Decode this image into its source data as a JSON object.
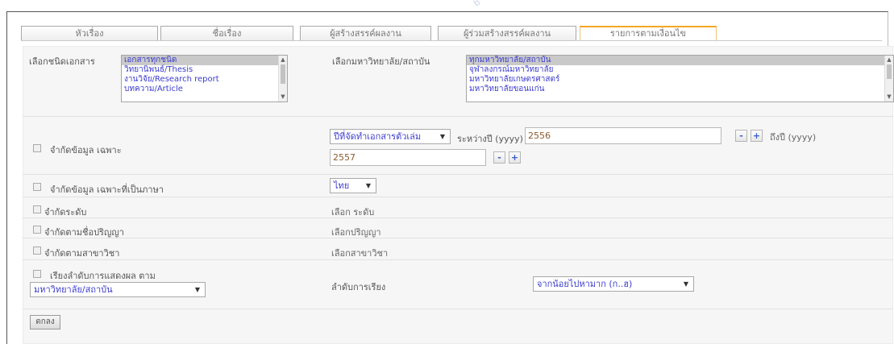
{
  "tabs": [
    {
      "label": "หัวเรื่อง",
      "active": false
    },
    {
      "label": "ชื่อเรื่อง",
      "active": false
    },
    {
      "label": "ผู้สร้างสรรค์ผลงาน",
      "active": false
    },
    {
      "label": "ผู้ร่วมสร้างสรรค์ผลงาน",
      "active": false
    },
    {
      "label": "รายการตามเงื่อนไข",
      "active": true
    }
  ],
  "watermark": "b",
  "doc_type": {
    "label": "เลือกชนิดเอกสาร",
    "options": [
      "เอกสารทุกชนิด",
      "วิทยานิพนธ์/Thesis",
      "งานวิจัย/Research report",
      "บทความ/Article"
    ],
    "selected_index": 0
  },
  "university": {
    "label": "เลือกมหาวิทยาลัย/สถาบัน",
    "options": [
      "ทุกมหาวิทยาลัย/สถาบัน",
      "จุฬาลงกรณ์มหาวิทยาลัย",
      "มหาวิทยาลัยเกษตรศาสตร์",
      "มหาวิทยาลัยขอนแก่น"
    ],
    "selected_index": 0
  },
  "filter_specific": {
    "label": "จำกัดข้อมูล เฉพาะ",
    "field_select": "ปีที่จัดทำเอกสารตัวเล่ม",
    "between_label": "ระหว่างปี (yyyy)",
    "from_year": "2556",
    "to_label": "ถึงปี (yyyy)",
    "to_year": "2557",
    "minus": "-",
    "plus": "+"
  },
  "filter_language": {
    "label": "จำกัดข้อมูล เฉพาะที่เป็นภาษา",
    "value": "ไทย"
  },
  "filter_level": {
    "label": "จำกัดระดับ",
    "value": "เลือก ระดับ"
  },
  "filter_degree": {
    "label": "จำกัดตามชื่อปริญญา",
    "value": "เลือกปริญญา"
  },
  "filter_major": {
    "label": "จำกัดตามสาขาวิชา",
    "value": "เลือกสาขาวิชา"
  },
  "sort": {
    "label": "เรียงลำดับการแสดงผล ตาม",
    "field_value": "มหาวิทยาลัย/สถาบัน",
    "order_label": "ลำดับการเรียง",
    "order_value": "จากน้อยไปหามาก (ก..ฮ)"
  },
  "ok_button": "ตกลง",
  "colors": {
    "accent_tab": "#f5a623",
    "link_blue": "#3c3ccf",
    "panel_bg": "#f6f6f6"
  }
}
